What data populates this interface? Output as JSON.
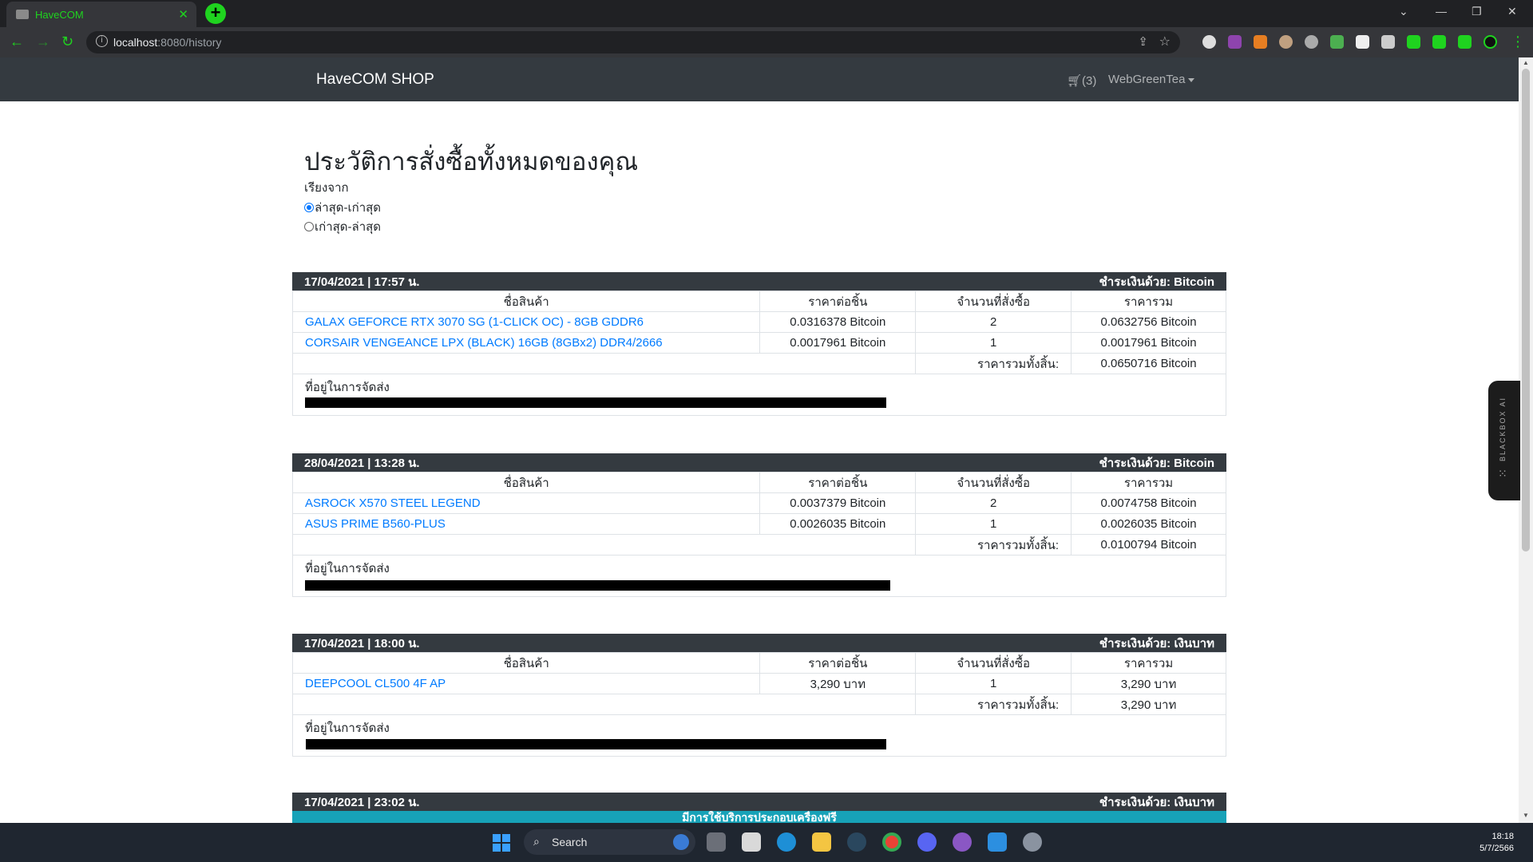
{
  "browser": {
    "tab_title": "HaveCOM",
    "url_host": "localhost",
    "url_rest": ":8080/history"
  },
  "navbar": {
    "brand": "HaveCOM SHOP",
    "cart": "(3)",
    "user": "WebGreenTea"
  },
  "page": {
    "title": "ประวัติการสั่งซื้อทั้งหมดของคุณ",
    "sort_label": "เรียงจาก",
    "sort_options": [
      "ล่าสุด-เก่าสุด",
      "เก่าสุด-ล่าสุด"
    ],
    "sort_selected": "ล่าสุด-เก่าสุด"
  },
  "table_headers": [
    "ชื่อสินค้า",
    "ราคาต่อชิ้น",
    "จำนวนที่สั่งซื้อ",
    "ราคารวม"
  ],
  "total_label": "ราคารวมทั้งสิ้น:",
  "address_label": "ที่อยู่ในการจัดส่ง",
  "orders": [
    {
      "datetime": "17/04/2021 | 17:57 น.",
      "payment": "ชำระเงินด้วย: Bitcoin",
      "items": [
        {
          "name": "GALAX GEFORCE RTX 3070 SG (1-CLICK OC) - 8GB GDDR6",
          "unit_price": "0.0316378 Bitcoin",
          "qty": "2",
          "subtotal": "0.0632756 Bitcoin"
        },
        {
          "name": "CORSAIR VENGEANCE LPX (BLACK) 16GB (8GBx2) DDR4/2666",
          "unit_price": "0.0017961 Bitcoin",
          "qty": "1",
          "subtotal": "0.0017961 Bitcoin"
        }
      ],
      "total": "0.0650716 Bitcoin"
    },
    {
      "datetime": "28/04/2021 | 13:28 น.",
      "payment": "ชำระเงินด้วย: Bitcoin",
      "items": [
        {
          "name": "ASROCK X570 STEEL LEGEND",
          "unit_price": "0.0037379 Bitcoin",
          "qty": "2",
          "subtotal": "0.0074758 Bitcoin"
        },
        {
          "name": "ASUS PRIME B560-PLUS",
          "unit_price": "0.0026035 Bitcoin",
          "qty": "1",
          "subtotal": "0.0026035 Bitcoin"
        }
      ],
      "total": "0.0100794 Bitcoin"
    },
    {
      "datetime": "17/04/2021 | 18:00 น.",
      "payment": "ชำระเงินด้วย: เงินบาท",
      "items": [
        {
          "name": "DEEPCOOL CL500 4F AP",
          "unit_price": "3,290 บาท",
          "qty": "1",
          "subtotal": "3,290 บาท"
        }
      ],
      "total": "3,290 บาท"
    },
    {
      "datetime": "17/04/2021 | 23:02 น.",
      "payment": "ชำระเงินด้วย: เงินบาท",
      "banner": "มีการใช้บริการประกอบเครื่องฟรี"
    }
  ],
  "blackbox_label": "BLACKBOX AI",
  "taskbar": {
    "search": "Search",
    "time": "18:18",
    "date": "5/7/2566"
  },
  "colors": {
    "navbar": "#343a40",
    "link": "#007bff",
    "accent_green": "#1fd31f",
    "banner": "#17a2b8"
  }
}
